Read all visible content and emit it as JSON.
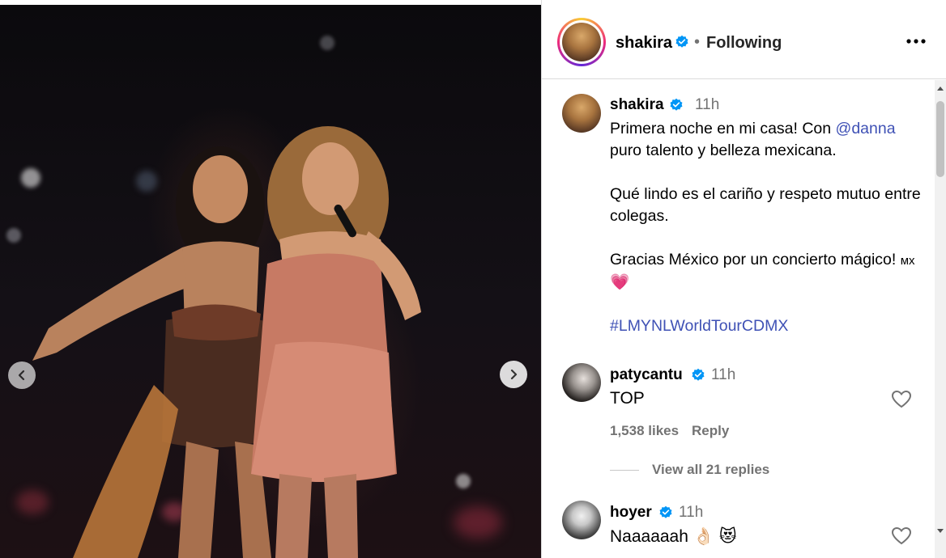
{
  "header": {
    "username": "shakira",
    "separator": "•",
    "follow_status": "Following"
  },
  "caption": {
    "username": "shakira",
    "time": "11h",
    "line1_prefix": "Primera noche en mi casa! Con ",
    "mention": "@danna",
    "line1_suffix": " puro talento y belleza mexicana.",
    "para2": "Qué lindo es el cariño y respeto mutuo entre colegas.",
    "para3_text": "Gracias México por un concierto mágico! ",
    "para3_flag": "мх",
    "para3_emoji": "💗",
    "hashtag": "#LMYNLWorldTourCDMX"
  },
  "comments": [
    {
      "username": "patycantu",
      "time": "11h",
      "text": "TOP",
      "likes": "1,538 likes",
      "reply_label": "Reply",
      "view_replies": "View all 21 replies"
    },
    {
      "username": "hoyer",
      "time": "11h",
      "text": "Naaaaaah 👌🏻 😻"
    }
  ],
  "icons": {
    "verified": "verified-badge-icon",
    "more": "more-options-icon",
    "heart": "heart-icon",
    "prev": "chevron-left-icon",
    "next": "chevron-right-icon"
  },
  "colors": {
    "verified": "#0095f6",
    "link": "#3f51b5",
    "secondary_text": "#737373"
  }
}
